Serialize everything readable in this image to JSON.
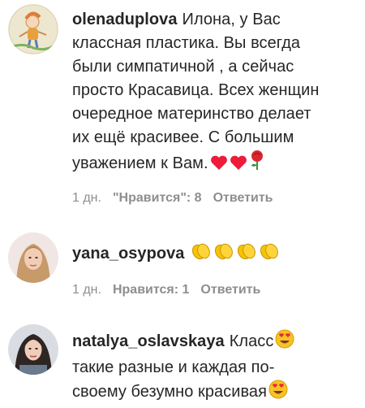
{
  "comments": [
    {
      "username": "olenaduplova",
      "lines": [
        "Илона, у Вас",
        "классная пластика. Вы всегда",
        "были симпатичной , а сейчас",
        "просто Красавица. Всех женщин",
        "очередное материнство делает",
        "их ещё красивее. С большим",
        "уважением к Вам."
      ],
      "emojis": [
        "heart-emoji",
        "heart-emoji",
        "rose-emoji"
      ],
      "time": "1 дн.",
      "likes": "\"Нравится\": 8",
      "reply": "Ответить"
    },
    {
      "username": "yana_osypova",
      "lines": [
        ""
      ],
      "emojis": [
        "clapping-hands-emoji",
        "clapping-hands-emoji",
        "clapping-hands-emoji",
        "clapping-hands-emoji"
      ],
      "time": "1 дн.",
      "likes": "Нравится: 1",
      "reply": "Ответить"
    },
    {
      "username": "natalya_oslavskaya",
      "lines": [
        "Класс",
        "такие разные и каждая по-",
        "своему безумно красивая"
      ],
      "emojis": [
        "heart-eyes-emoji",
        "heart-eyes-emoji"
      ]
    }
  ],
  "colors": {
    "text": "#262626",
    "meta": "#8e8e8e",
    "heart": "#ed1c3a",
    "clap": "#f5c400"
  }
}
